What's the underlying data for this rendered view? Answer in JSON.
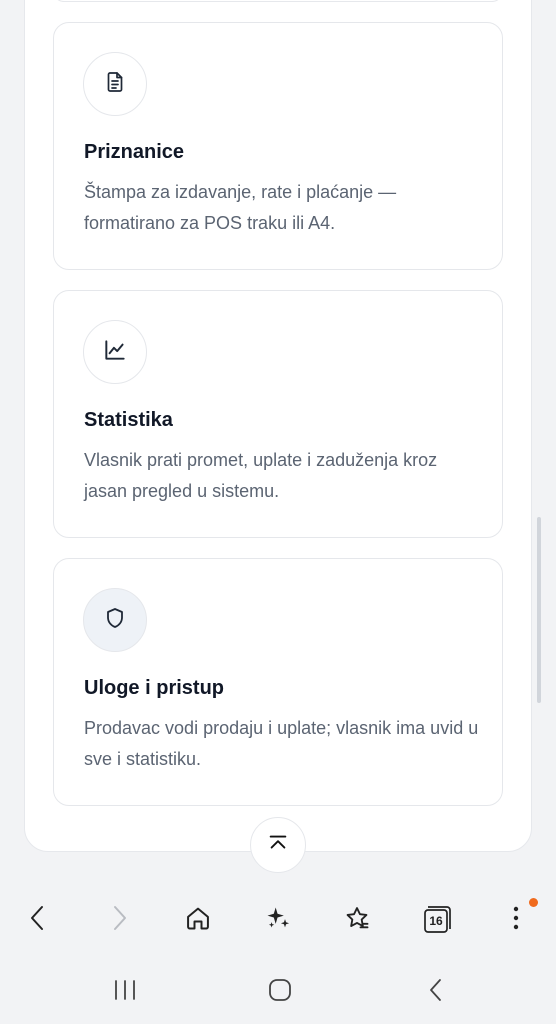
{
  "cards": [
    {
      "icon": "document-icon",
      "title": "Priznanice",
      "description": "Štampa za izdavanje, rate i plaćanje — formatirano za POS traku ili A4."
    },
    {
      "icon": "line-chart-icon",
      "title": "Statistika",
      "description": "Vlasnik prati promet, uplate i zaduženja kroz jasan pregled u sistemu."
    },
    {
      "icon": "shield-icon",
      "title": "Uloge i pristup",
      "description": "Prodavac vodi prodaju i uplate; vlasnik ima uvid u sve i statistiku."
    }
  ],
  "browser": {
    "tabs_count": "16",
    "notification_color": "#f06a1d"
  },
  "colors": {
    "background": "#f2f3f5",
    "card_border": "#e5e7eb",
    "title": "#111827",
    "description": "#5b6472"
  }
}
